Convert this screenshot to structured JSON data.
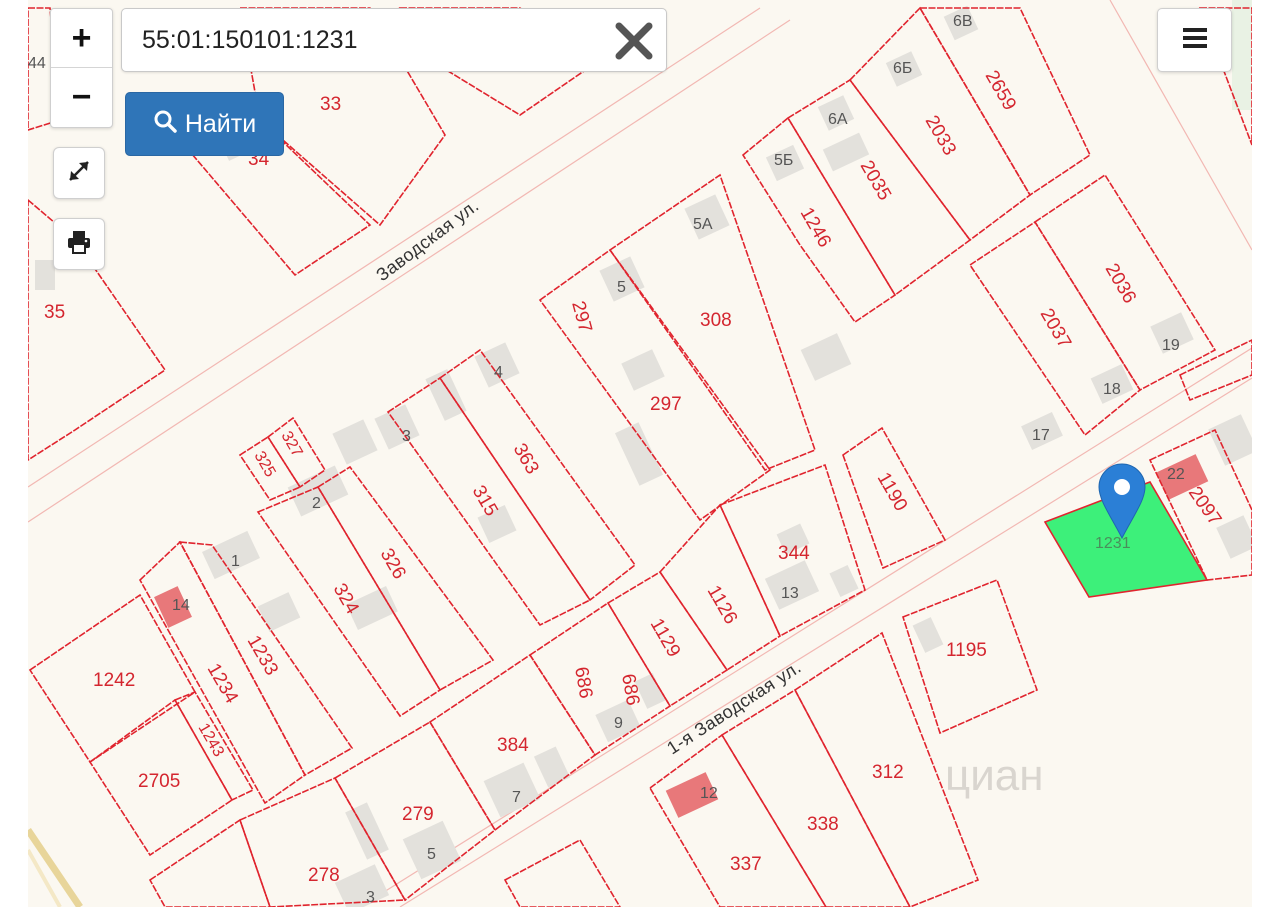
{
  "search": {
    "value": "55:01:150101:1231",
    "find_label": "Найти"
  },
  "controls": {
    "zoom_in_label": "+",
    "zoom_out_label": "−",
    "icons": [
      "search-icon",
      "clear-icon",
      "fullscreen-icon",
      "print-icon",
      "menu-icon",
      "map-pin-icon"
    ]
  },
  "map": {
    "streets": [
      "Заводская ул.",
      "1-я Заводская ул."
    ],
    "parcel_labels": [
      "44",
      "33",
      "34",
      "35",
      "6В",
      "6Б",
      "6А",
      "5Б",
      "2659",
      "2033",
      "2035",
      "1246",
      "5А",
      "308",
      "297",
      "297",
      "2036",
      "2037",
      "19",
      "18",
      "17",
      "363",
      "315",
      "327",
      "325",
      "1190",
      "22",
      "2097",
      "1231",
      "344",
      "13",
      "1126",
      "1129",
      "326",
      "324",
      "1233",
      "1234",
      "1242",
      "1243",
      "2705",
      "1195",
      "686",
      "686",
      "9",
      "384",
      "7",
      "279",
      "5",
      "278",
      "3",
      "312",
      "338",
      "337",
      "12",
      "1",
      "2",
      "3",
      "4",
      "5",
      "14"
    ],
    "highlighted_parcel": "1231",
    "watermark": "циан",
    "colors": {
      "parcel_border": "#e0242e",
      "highlight_fill": "#3df07a",
      "pin": "#2b7fd6",
      "button_primary": "#2f75b8"
    }
  }
}
